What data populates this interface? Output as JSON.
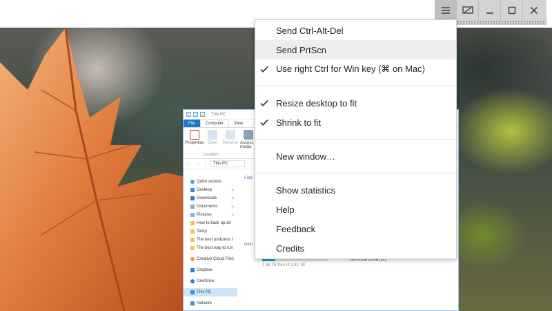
{
  "menu": {
    "items": [
      {
        "label": "Send Ctrl-Alt-Del",
        "checked": false
      },
      {
        "label": "Send PrtScn",
        "checked": false,
        "highlighted": true
      },
      {
        "label": "Use right Ctrl for Win key (⌘ on Mac)",
        "checked": true
      },
      {
        "label": "Resize desktop to fit",
        "checked": true
      },
      {
        "label": "Shrink to fit",
        "checked": true
      },
      {
        "label": "New window…",
        "checked": false
      },
      {
        "label": "Show statistics",
        "checked": false
      },
      {
        "label": "Help",
        "checked": false
      },
      {
        "label": "Feedback",
        "checked": false
      },
      {
        "label": "Credits",
        "checked": false
      }
    ]
  },
  "toolbar": {
    "menu_icon": "hamburger-icon",
    "display_icon": "monitor-icon",
    "minimize_icon": "minimize-icon",
    "maximize_icon": "maximize-icon",
    "close_icon": "close-icon"
  },
  "explorer": {
    "window_title": "This PC",
    "tabs": {
      "file": "File",
      "computer": "Computer",
      "view": "View"
    },
    "ribbon": {
      "properties": "Properties",
      "open": "Open",
      "rename": "Rename",
      "access_media": "Access media",
      "location": "Location"
    },
    "address": "This PC",
    "nav": {
      "quick_access": "Quick access",
      "desktop": "Desktop",
      "downloads": "Downloads",
      "documents": "Documents",
      "pictures": "Pictures",
      "backup": "How to back up all",
      "temp": "Temp",
      "podcasts": "The best podcasts f",
      "bestway": "The best way to run",
      "creative": "Creative Cloud Files",
      "dropbox": "Dropbox",
      "onedrive": "OneDrive",
      "thispc": "This PC",
      "network": "Network"
    },
    "content": {
      "folders": "Fold",
      "devices": "Devi",
      "drive_free": "1.35 TB free of 1.81 TB",
      "bd_drive": "BD-ROM Drive (D:)"
    }
  },
  "colors": {
    "menu_highlight": "#eeeeee",
    "toolbar_bg": "#d4d4d4",
    "explorer_file_tab": "#1979ca",
    "selected_nav": "#cce4f7"
  }
}
